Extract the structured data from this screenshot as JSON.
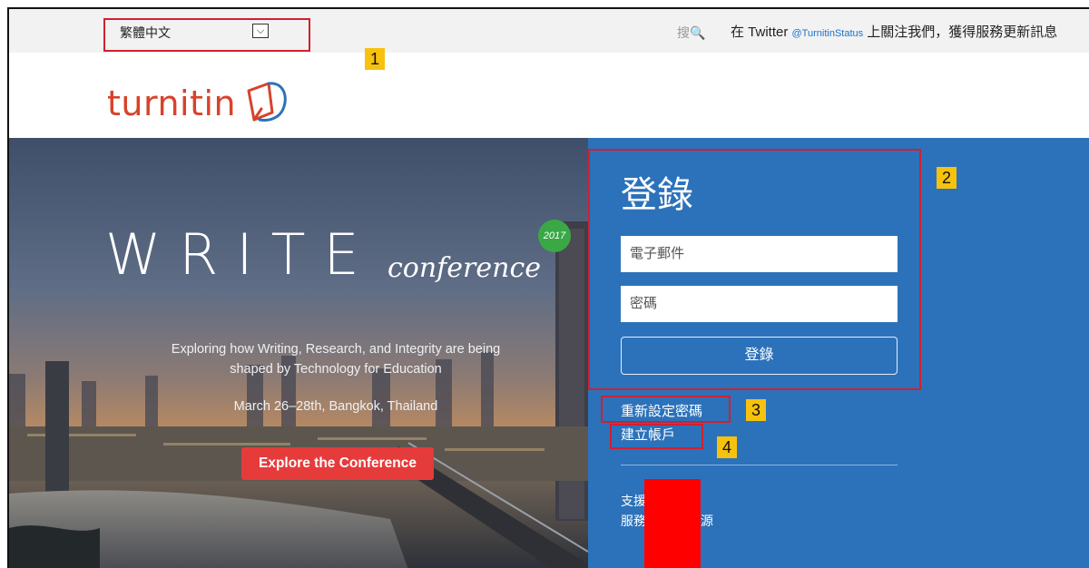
{
  "topbar": {
    "language": "繁體中文",
    "search_text": "搜",
    "twitter_before": "在 Twitter ",
    "twitter_handle": "@TurnitinStatus",
    "twitter_after": " 上關注我們，獲得服務更新訊息"
  },
  "brand": {
    "name": "turnitin"
  },
  "hero": {
    "title": "WRITE",
    "title_script": "conference",
    "year_badge": "2017",
    "tagline_line1": "Exploring how Writing, Research, and Integrity are being",
    "tagline_line2": "shaped by Technology for Education",
    "date_location": "March 26–28th, Bangkok, Thailand",
    "cta_label": "Explore the Conference"
  },
  "login": {
    "title": "登錄",
    "email_placeholder": "電子郵件",
    "password_placeholder": "密碼",
    "submit_label": "登錄",
    "reset_password_link": "重新設定密碼",
    "create_account_link": "建立帳戶",
    "support_line1_visible": "支援",
    "support_line2_prefix": "服務",
    "support_line2_suffix": "源"
  },
  "annotations": [
    "1",
    "2",
    "3",
    "4"
  ],
  "colors": {
    "brand_red": "#d7432b",
    "panel_blue": "#2c72ba",
    "cta_red": "#e63b3b",
    "callout_border": "#d1202f",
    "callout_fill": "#f6c20e",
    "redaction": "#ff0000"
  },
  "icons": {
    "search": "magnifier-icon",
    "dropdown": "chevron-down-icon",
    "logo": "turnitin-logo-icon"
  }
}
